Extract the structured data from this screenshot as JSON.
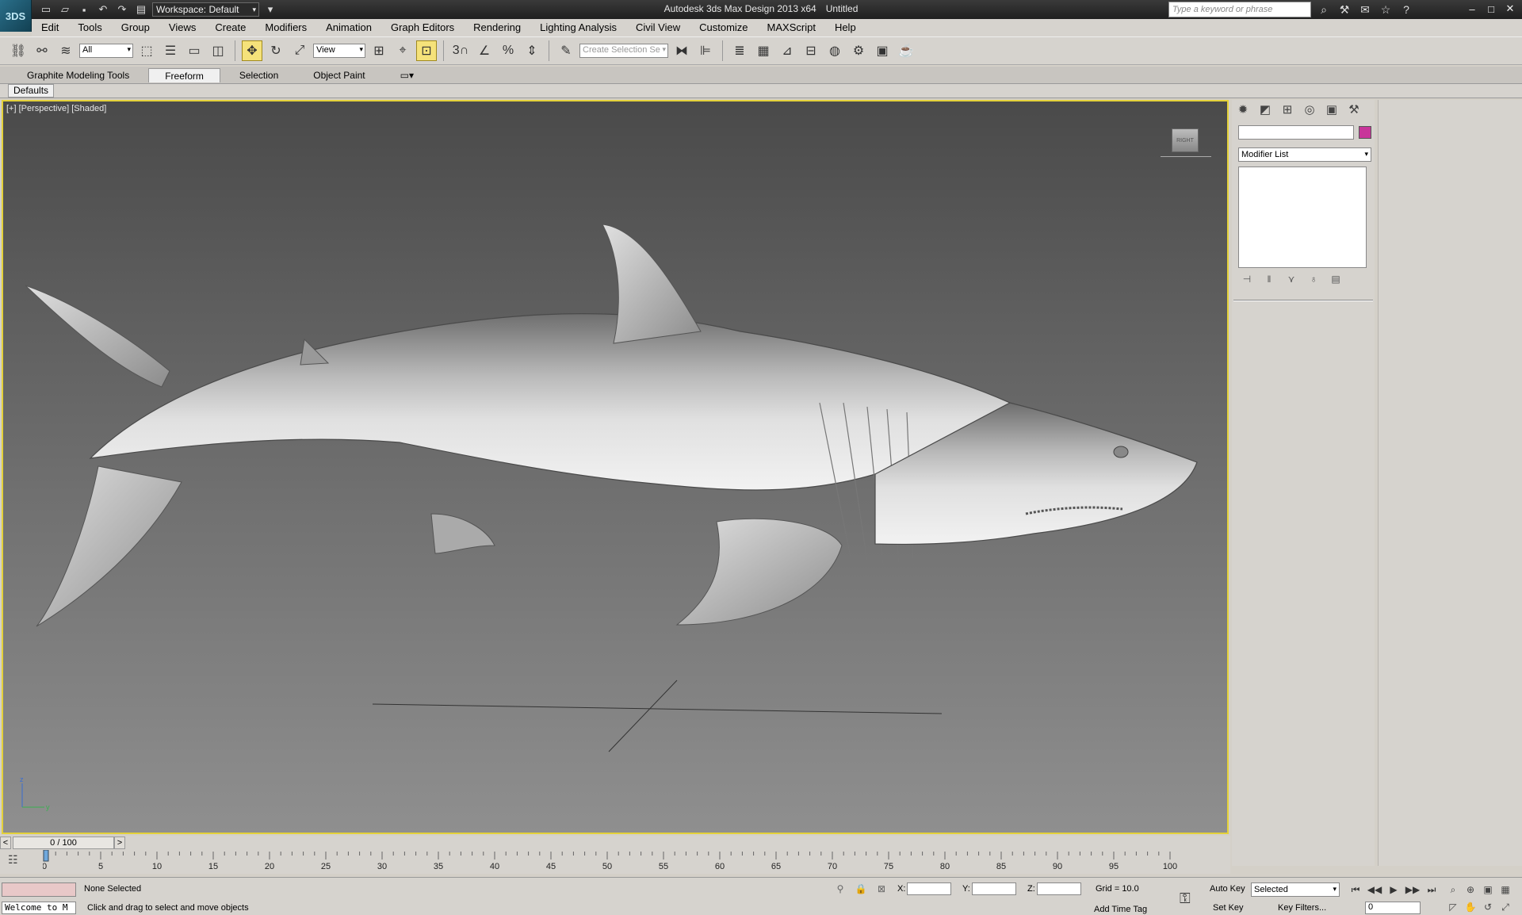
{
  "app": {
    "logo_text": "3DS",
    "title": "Autodesk 3ds Max Design 2013 x64",
    "document": "Untitled",
    "workspace": "Workspace: Default",
    "search_placeholder": "Type a keyword or phrase"
  },
  "menu": [
    "Edit",
    "Tools",
    "Group",
    "Views",
    "Create",
    "Modifiers",
    "Animation",
    "Graph Editors",
    "Rendering",
    "Lighting Analysis",
    "Civil View",
    "Customize",
    "MAXScript",
    "Help"
  ],
  "toolbar": {
    "selection_filter": "All",
    "reference_coord": "View",
    "named_selection_placeholder": "Create Selection Se",
    "snap_label": "3"
  },
  "ribbon": {
    "tabs": [
      "Graphite Modeling Tools",
      "Freeform",
      "Selection",
      "Object Paint"
    ],
    "active_tab": "Freeform",
    "sub_tab": "Defaults"
  },
  "viewport": {
    "label": "[+] [Perspective] [Shaded]",
    "viewcube_face": "RIGHT",
    "axis_z": "z",
    "axis_y": "y",
    "border_color": "#e4d13a"
  },
  "command_panel": {
    "modifier_list": "Modifier List",
    "object_color": "#c8359a"
  },
  "timeline": {
    "frame_display": "0 / 100",
    "prev": "<",
    "next": ">",
    "ticks": [
      "0",
      "5",
      "10",
      "15",
      "20",
      "25",
      "30",
      "35",
      "40",
      "45",
      "50",
      "55",
      "60",
      "65",
      "70",
      "75",
      "80",
      "85",
      "90",
      "95",
      "100"
    ]
  },
  "status": {
    "welcome": "Welcome to M",
    "selection": "None Selected",
    "prompt": "Click and drag to select and move objects",
    "x_label": "X:",
    "y_label": "Y:",
    "z_label": "Z:",
    "grid": "Grid = 10.0",
    "add_time_tag": "Add Time Tag",
    "auto_key": "Auto Key",
    "set_key": "Set Key",
    "key_mode": "Selected",
    "key_filters": "Key Filters...",
    "current_frame": "0"
  }
}
